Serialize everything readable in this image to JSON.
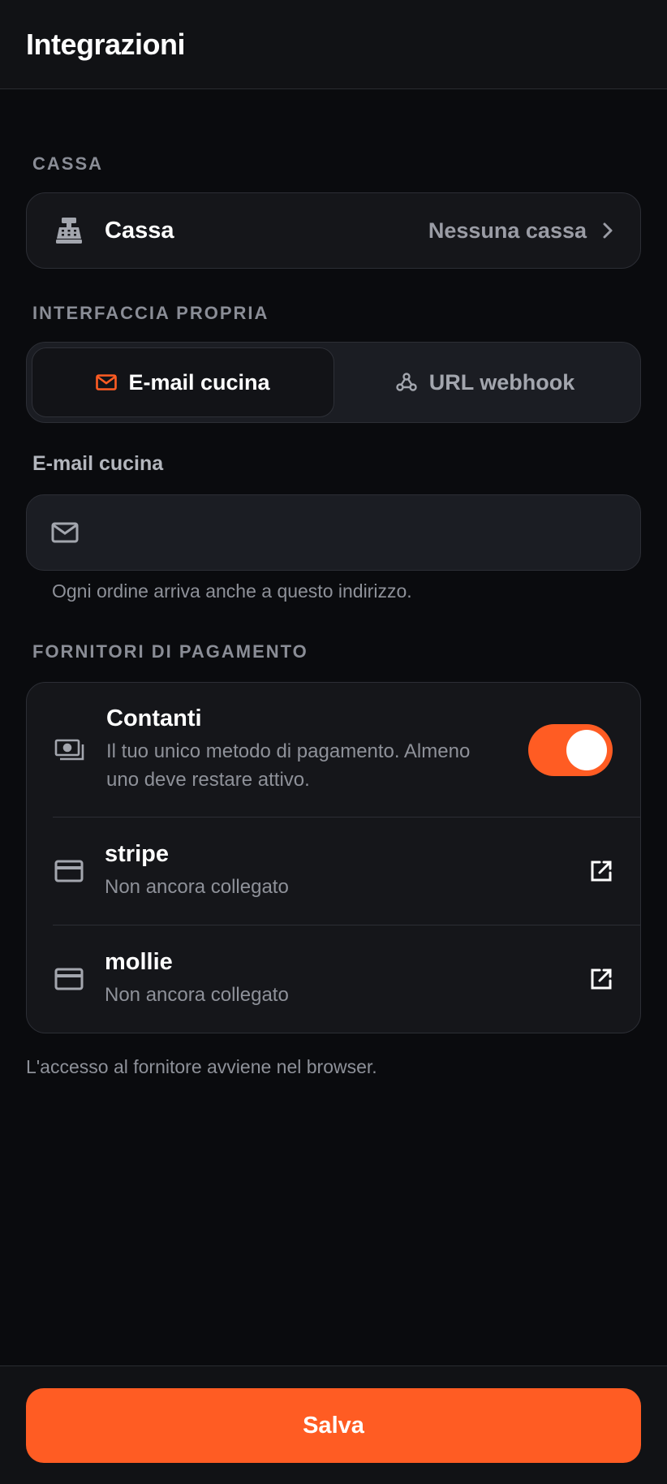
{
  "header": {
    "title": "Integrazioni"
  },
  "cassa_section": {
    "label": "CASSA",
    "row": {
      "title": "Cassa",
      "value": "Nessuna cassa"
    }
  },
  "interface_section": {
    "label": "INTERFACCIA PROPRIA",
    "tabs": [
      {
        "label": "E-mail cucina",
        "icon": "mail-icon",
        "active": true
      },
      {
        "label": "URL webhook",
        "icon": "webhook-icon",
        "active": false
      }
    ],
    "email_field": {
      "label": "E-mail cucina",
      "value": "",
      "placeholder": ""
    },
    "hint": "Ogni ordine arriva anche a questo indirizzo."
  },
  "payments_section": {
    "label": "FORNITORI DI PAGAMENTO",
    "providers": [
      {
        "name": "Contanti",
        "subtitle": "Il tuo unico metodo di pagamento. Almeno uno deve restare attivo.",
        "icon": "cash-icon",
        "enabled": true
      },
      {
        "name": "stripe",
        "subtitle": "Non ancora collegato",
        "icon": "credit-card-icon",
        "action_icon": "external-link-icon"
      },
      {
        "name": "mollie",
        "subtitle": "Non ancora collegato",
        "icon": "credit-card-icon",
        "action_icon": "external-link-icon"
      }
    ],
    "note": "L'accesso al fornitore avviene nel browser."
  },
  "footer": {
    "save_label": "Salva"
  },
  "colors": {
    "accent": "#ff5c23",
    "background": "#0a0b0e",
    "card": "#15161a"
  }
}
